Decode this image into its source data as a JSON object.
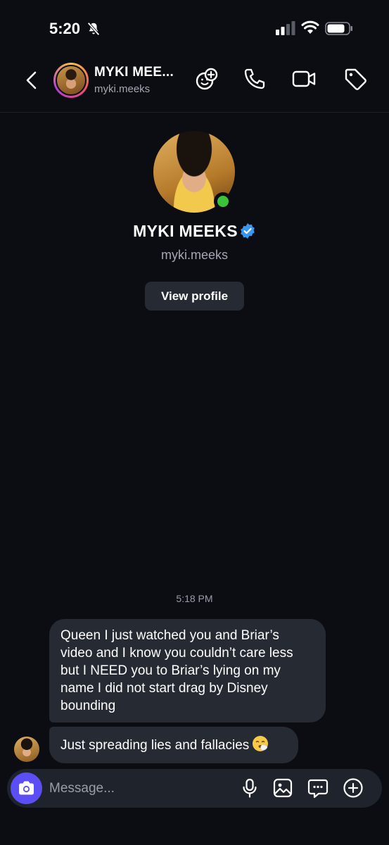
{
  "status_bar": {
    "time": "5:20",
    "icons": [
      "bell-slash-icon",
      "cellular-signal-icon",
      "wifi-icon",
      "battery-icon"
    ]
  },
  "header": {
    "name": "MYKI MEE...",
    "username": "myki.meeks",
    "icons": [
      "back-chevron-icon",
      "add-people-icon",
      "phone-icon",
      "video-camera-icon",
      "tag-icon"
    ]
  },
  "profile": {
    "name": "MYKI MEEKS",
    "username": "myki.meeks",
    "verified": true,
    "online": true,
    "view_profile_label": "View profile"
  },
  "conversation": {
    "timestamp": "5:18 PM",
    "messages": [
      {
        "text": "Queen I just watched you and Briar’s video and I know you couldn’t care less but I NEED you to Briar’s lying on my name I did not start drag by Disney bounding"
      },
      {
        "text": "Just spreading lies and fallacies",
        "emoji": "sneezing-face-icon"
      }
    ]
  },
  "composer": {
    "placeholder": "Message...",
    "icons": [
      "camera-icon",
      "microphone-icon",
      "gallery-icon",
      "sticker-chat-icon",
      "plus-circle-icon"
    ]
  },
  "colors": {
    "background": "#0b0d12",
    "bubble": "#262a33",
    "accent": "#5b4ef5",
    "online": "#3ac43a",
    "verified": "#3897f0"
  }
}
